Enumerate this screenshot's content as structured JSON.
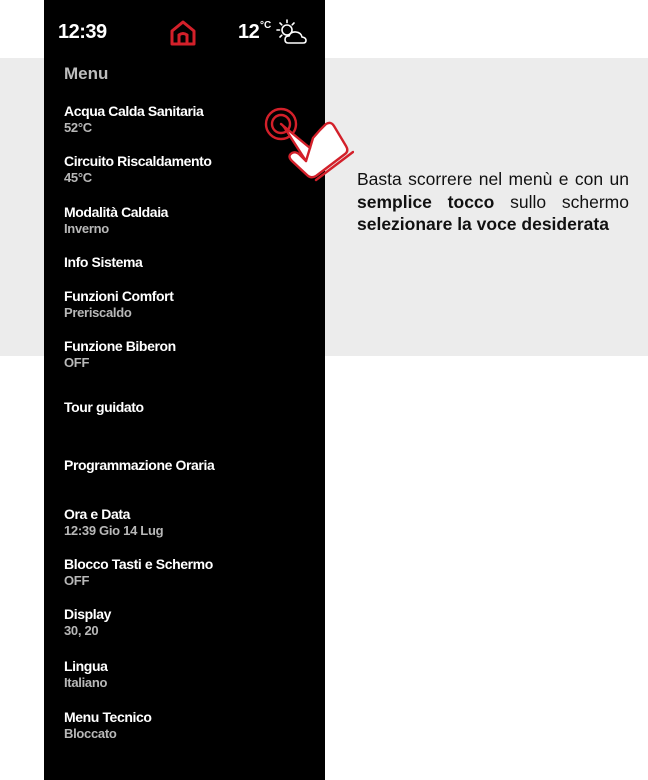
{
  "status_bar": {
    "time": "12:39",
    "temperature": "12",
    "temperature_unit": "°C",
    "home_icon": "home-icon",
    "weather_icon": "sun-behind-cloud-icon"
  },
  "menu": {
    "title": "Menu",
    "items": [
      {
        "label": "Acqua Calda Sanitaria",
        "value": "52°C"
      },
      {
        "label": "Circuito Riscaldamento",
        "value": "45°C"
      },
      {
        "label": "Modalità Caldaia",
        "value": "Inverno"
      },
      {
        "label": "Info Sistema",
        "value": ""
      },
      {
        "label": "Funzioni Comfort",
        "value": "Preriscaldo"
      },
      {
        "label": "Funzione Biberon",
        "value": "OFF"
      },
      {
        "label": "Tour guidato",
        "value": ""
      },
      {
        "label": "Programmazione Oraria",
        "value": ""
      },
      {
        "label": "Ora e Data",
        "value": "12:39 Gio 14 Lug"
      },
      {
        "label": "Blocco Tasti e Schermo",
        "value": "OFF"
      },
      {
        "label": "Display",
        "value": "30, 20"
      },
      {
        "label": "Lingua",
        "value": "Italiano"
      },
      {
        "label": "Menu Tecnico",
        "value": "Bloccato"
      }
    ]
  },
  "caption": {
    "part1": "Basta scorrere nel menù e con un ",
    "bold1": "semplice tocco",
    "part2": " sullo schermo ",
    "bold2": "selezionare la voce desiderata"
  },
  "colors": {
    "accent": "#d3202a",
    "panel": "#000000",
    "band": "#ececec"
  },
  "gesture_icon": "tap-hand-icon"
}
